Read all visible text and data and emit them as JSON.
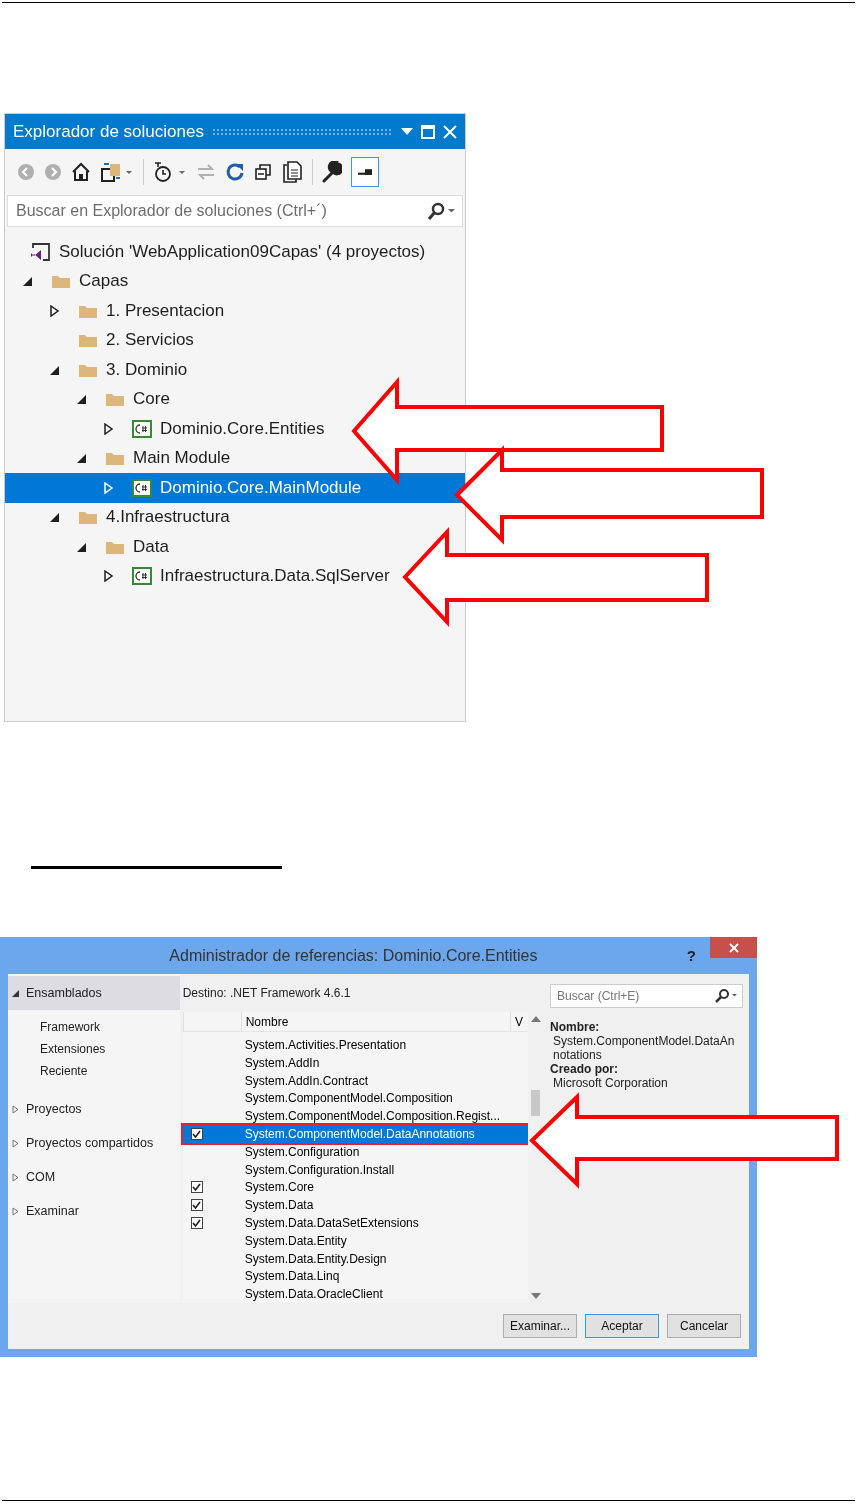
{
  "solution_explorer": {
    "title": "Explorador de soluciones",
    "search": {
      "placeholder": "Buscar en Explorador de soluciones (Ctrl+´)"
    },
    "solution": {
      "label": "Solución 'WebApplication09Capas'  (4 proyectos)",
      "children": [
        {
          "label": "Capas",
          "kind": "folder",
          "expanded": true,
          "selected": false,
          "children": [
            {
              "label": "1. Presentacion",
              "kind": "folder",
              "expanded": false,
              "selected": false
            },
            {
              "label": "2. Servicios",
              "kind": "folder",
              "selected": false
            },
            {
              "label": "3. Dominio",
              "kind": "folder",
              "expanded": true,
              "selected": false,
              "children": [
                {
                  "label": "Core",
                  "kind": "folder",
                  "expanded": true,
                  "selected": false,
                  "children": [
                    {
                      "label": "Dominio.Core.Entities",
                      "kind": "project",
                      "expanded": false,
                      "selected": false
                    }
                  ]
                },
                {
                  "label": "Main Module",
                  "kind": "folder",
                  "expanded": true,
                  "selected": false,
                  "children": [
                    {
                      "label": "Dominio.Core.MainModule",
                      "kind": "project",
                      "expanded": false,
                      "selected": true
                    }
                  ]
                }
              ]
            },
            {
              "label": "4.Infraestructura",
              "kind": "folder",
              "expanded": true,
              "selected": false,
              "children": [
                {
                  "label": "Data",
                  "kind": "folder",
                  "expanded": true,
                  "selected": false,
                  "children": [
                    {
                      "label": "Infraestructura.Data.SqlServer",
                      "kind": "project",
                      "expanded": false,
                      "selected": false
                    }
                  ]
                }
              ]
            }
          ]
        }
      ]
    }
  },
  "reference_manager": {
    "title": "Administrador de referencias: Dominio.Core.Entities",
    "help": "?",
    "sidebar": [
      {
        "label": "Ensamblados",
        "expanded": true,
        "selected": true,
        "children": [
          "Framework",
          "Extensiones",
          "Reciente"
        ]
      },
      {
        "label": "Proyectos",
        "expanded": false,
        "selected": false
      },
      {
        "label": "Proyectos compartidos",
        "expanded": false,
        "selected": false
      },
      {
        "label": "COM",
        "expanded": false,
        "selected": false
      },
      {
        "label": "Examinar",
        "expanded": false,
        "selected": false
      }
    ],
    "target": "Destino: .NET Framework 4.6.1",
    "columns": [
      "Nombre",
      "V"
    ],
    "rows": [
      {
        "name": "System.Activities.Presentation",
        "checked": false,
        "selected": false
      },
      {
        "name": "System.AddIn",
        "checked": false,
        "selected": false
      },
      {
        "name": "System.AddIn.Contract",
        "checked": false,
        "selected": false
      },
      {
        "name": "System.ComponentModel.Composition",
        "checked": false,
        "selected": false
      },
      {
        "name": "System.ComponentModel.Composition.Regist...",
        "checked": false,
        "selected": false
      },
      {
        "name": "System.ComponentModel.DataAnnotations",
        "checked": true,
        "selected": true
      },
      {
        "name": "System.Configuration",
        "checked": false,
        "selected": false
      },
      {
        "name": "System.Configuration.Install",
        "checked": false,
        "selected": false
      },
      {
        "name": "System.Core",
        "checked": true,
        "selected": false
      },
      {
        "name": "System.Data",
        "checked": true,
        "selected": false
      },
      {
        "name": "System.Data.DataSetExtensions",
        "checked": true,
        "selected": false
      },
      {
        "name": "System.Data.Entity",
        "checked": false,
        "selected": false
      },
      {
        "name": "System.Data.Entity.Design",
        "checked": false,
        "selected": false
      },
      {
        "name": "System.Data.Linq",
        "checked": false,
        "selected": false
      },
      {
        "name": "System.Data.OracleClient",
        "checked": false,
        "selected": false
      }
    ],
    "search": {
      "placeholder": "Buscar (Ctrl+E)"
    },
    "details": [
      {
        "kind": "label",
        "text": "Nombre:"
      },
      {
        "kind": "value",
        "text": "System.ComponentModel.DataAnnotations"
      },
      {
        "kind": "label",
        "text": "Creado por:"
      },
      {
        "kind": "value",
        "text": "Microsoft Corporation"
      }
    ],
    "buttons": [
      "Examinar...",
      "Aceptar",
      "Cancelar"
    ]
  }
}
